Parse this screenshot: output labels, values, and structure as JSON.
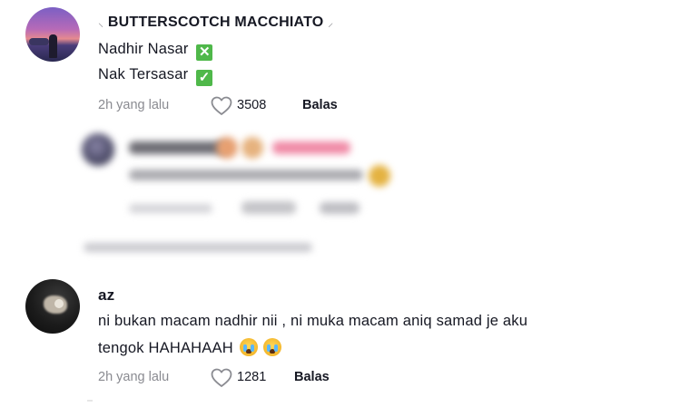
{
  "comments": [
    {
      "username": "BUTTERSCOTCH MACCHIATO",
      "lines": [
        "Nadhir Nasar",
        "Nak Tersasar"
      ],
      "marks": [
        "✕",
        "✓"
      ],
      "time": "2h yang lalu",
      "likes": "3508",
      "reply": "Balas",
      "icon": "heart-outline-icon"
    },
    {
      "username": "az",
      "lines": [
        "ni bukan macam nadhir nii , ni muka macam aniq samad je aku",
        "tengok HAHAHAAH"
      ],
      "emoji": "loudly-crying-face-icon",
      "time": "2h yang lalu",
      "likes": "1281",
      "reply": "Balas",
      "icon": "heart-outline-icon"
    }
  ],
  "colors": {
    "text": "#161823",
    "muted": "#8a8b91",
    "check_green": "#4fb84a"
  }
}
